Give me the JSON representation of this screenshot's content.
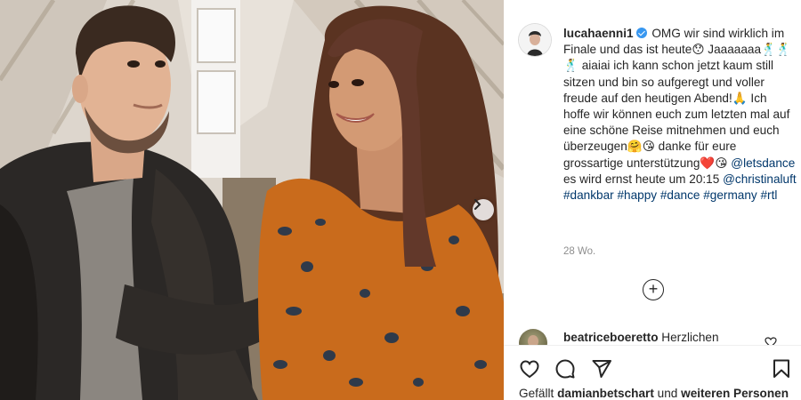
{
  "post": {
    "author": "lucahaenni1",
    "caption_parts": {
      "intro": "OMG wir sind wirklich im Finale und das ist heute😯 Jaaaaaaa🕺🕺🕺 aiaiai ich kann schon jetzt kaum still sitzen und bin so aufgeregt und voller freude auf den heutigen Abend!🙏 Ich hoffe wir können euch zum letzten mal auf eine schöne Reise mitnehmen und euch überzeugen🤗😘 danke für eure grossartige unterstützung❤️😘",
      "mention_1": "@letsdance",
      "middle": " es wird ernst heute um 20:15 ",
      "mention_2": "@christinaluft",
      "hashtags": [
        "#dankbar",
        "#happy",
        "#dance",
        "#germany",
        "#rtl"
      ]
    },
    "timestamp": "28 Wo."
  },
  "comment": {
    "author": "beatriceboeretto",
    "text": "Herzlichen"
  },
  "likes": {
    "prefix": "Gefällt",
    "user": "damianbetschart",
    "connector": "und",
    "others": "weiteren Personen"
  },
  "icons": {
    "carousel_next": "chevron-right-icon",
    "load_more": "plus-circle-icon",
    "like": "heart-icon",
    "comment": "comment-icon",
    "share": "paper-plane-icon",
    "save": "bookmark-icon",
    "verified": "verified-badge-icon",
    "comment_like": "small-heart-icon"
  },
  "colors": {
    "link": "#00376b",
    "verified": "#3897f0",
    "muted": "#8e8e8e"
  }
}
